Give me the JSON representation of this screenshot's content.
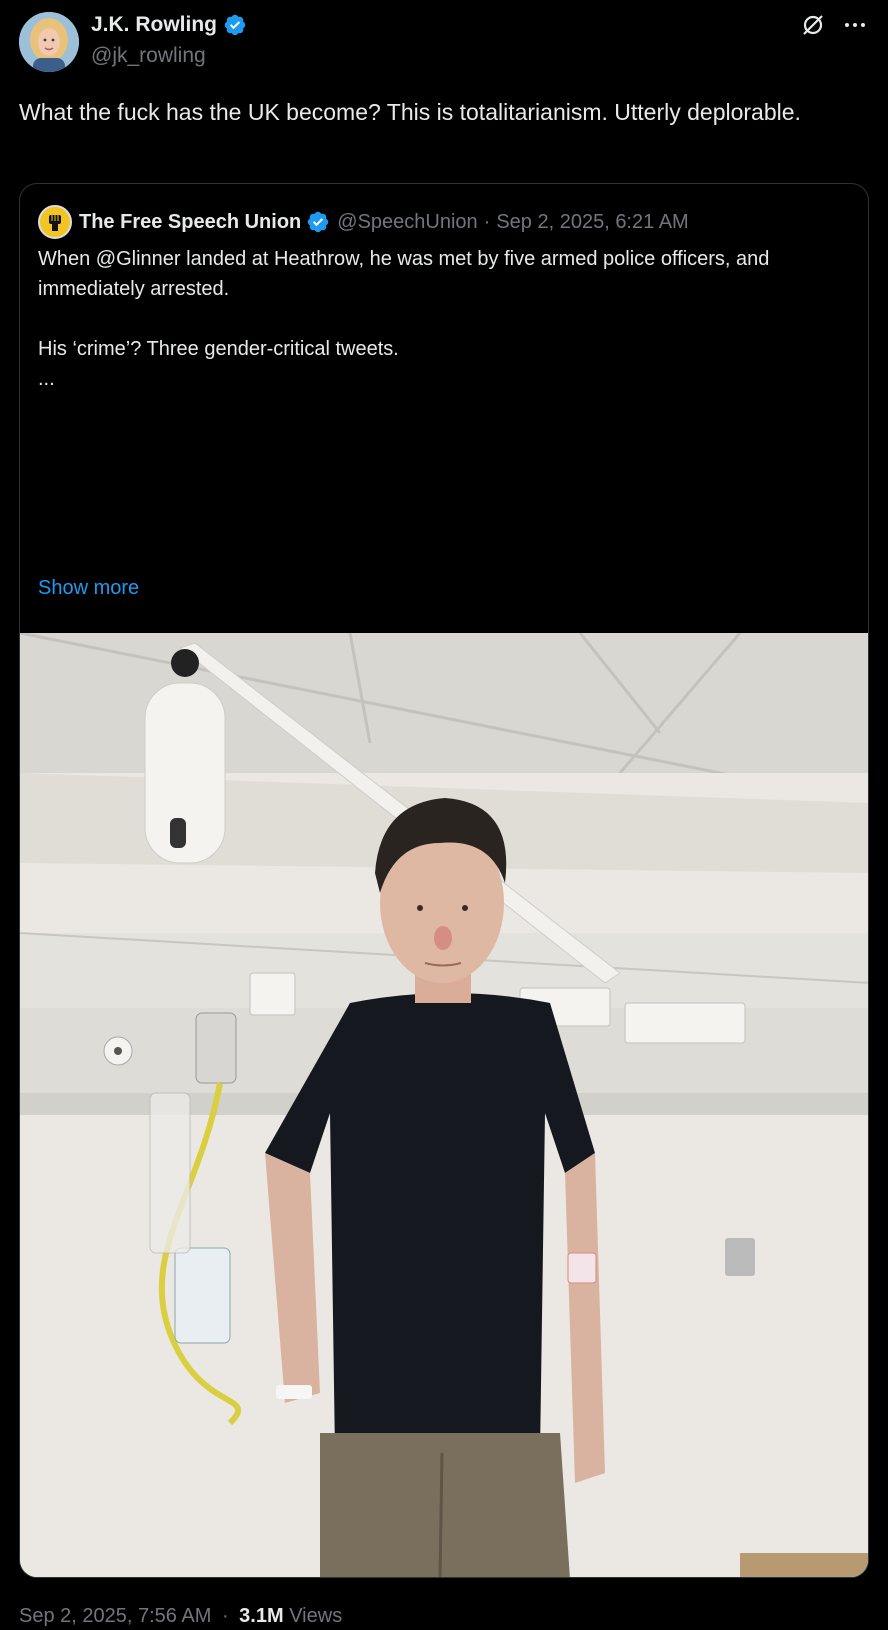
{
  "author": {
    "name": "J.K. Rowling",
    "handle": "@jk_rowling",
    "verified_color": "#1d9bf0"
  },
  "icons": {
    "grok": "grok-icon",
    "more": "more-icon",
    "verified": "verified-badge-icon"
  },
  "post": {
    "text": "What the fuck has the UK become? This is totalitarianism. Utterly deplorable."
  },
  "quote": {
    "name": "The Free Speech Union",
    "handle": "@SpeechUnion",
    "separator": "·",
    "timestamp": "Sep 2, 2025, 6:21 AM",
    "paragraph1": "When @Glinner landed at Heathrow, he was met by five armed police officers, and immediately arrested.",
    "paragraph2": "His ‘crime’? Three gender-critical tweets.",
    "ellipsis": "...",
    "show_more": "Show more",
    "media_description_icon": "photo"
  },
  "footer": {
    "timestamp": "Sep 2, 2025, 7:56 AM",
    "separator": "·",
    "views_count": "3.1M",
    "views_label": "Views"
  },
  "colors": {
    "background": "#000000",
    "text": "#e7e9ea",
    "muted": "#71767b",
    "link": "#1d9bf0",
    "border": "#2f3336"
  }
}
